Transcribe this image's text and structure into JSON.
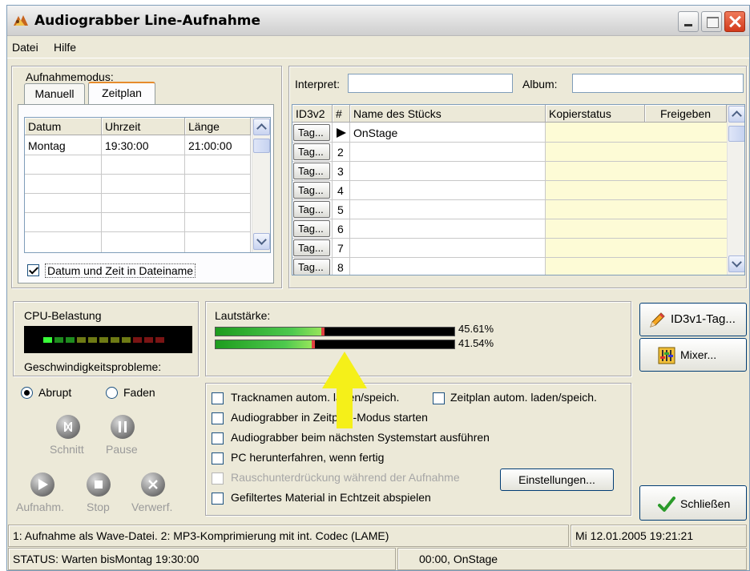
{
  "window": {
    "title": "Audiograbber Line-Aufnahme"
  },
  "menu": [
    {
      "label": "Datei"
    },
    {
      "label": "Hilfe"
    }
  ],
  "recording_mode": {
    "title": "Aufnahmemodus:",
    "tabs": [
      {
        "label": "Manuell"
      },
      {
        "label": "Zeitplan",
        "active": true
      }
    ],
    "schedule_table": {
      "columns": [
        "Datum",
        "Uhrzeit",
        "Länge"
      ],
      "rows": [
        [
          "Montag",
          "19:30:00",
          "21:00:00"
        ]
      ]
    },
    "date_in_filename": {
      "label": "Datum und Zeit in Dateiname",
      "checked": true
    }
  },
  "track_info": {
    "artist_label": "Interpret:",
    "artist_value": "",
    "album_label": "Album:",
    "album_value": "",
    "columns": [
      "ID3v2",
      "#",
      "Name des Stücks",
      "Kopierstatus",
      "Freigeben"
    ],
    "tag_button_label": "Tag...",
    "rows": [
      {
        "num": "",
        "name": "OnStage",
        "playing": true
      },
      {
        "num": "2",
        "name": ""
      },
      {
        "num": "3",
        "name": ""
      },
      {
        "num": "4",
        "name": ""
      },
      {
        "num": "5",
        "name": ""
      },
      {
        "num": "6",
        "name": ""
      },
      {
        "num": "7",
        "name": ""
      },
      {
        "num": "8",
        "name": ""
      }
    ]
  },
  "cpu": {
    "title": "CPU-Belastung",
    "footer": "Geschwindigkeitsprobleme:"
  },
  "volume": {
    "title": "Lautstärke:",
    "left_percent": 45.61,
    "right_percent": 41.54,
    "left_label": "45.61%",
    "right_label": "41.54%"
  },
  "buttons": {
    "id3v1": "ID3v1-Tag...",
    "mixer": "Mixer...",
    "settings": "Einstellungen...",
    "close": "Schließen"
  },
  "transition": {
    "abrupt": {
      "label": "Abrupt",
      "checked": true
    },
    "fade": {
      "label": "Faden",
      "checked": false
    }
  },
  "controls": {
    "cut": "Schnitt",
    "pause": "Pause",
    "record": "Aufnahm.",
    "stop": "Stop",
    "discard": "Verwerf."
  },
  "options": [
    {
      "label": "Tracknamen autom. laden/speich.",
      "checked": false,
      "disabled": false
    },
    {
      "label": "Zeitplan autom. laden/speich.",
      "checked": false,
      "disabled": false
    },
    {
      "label": "Audiograbber in Zeitplan-Modus starten",
      "checked": false,
      "disabled": false
    },
    {
      "label": "Audiograbber beim nächsten Systemstart ausführen",
      "checked": false,
      "disabled": false
    },
    {
      "label": "PC herunterfahren, wenn fertig",
      "checked": false,
      "disabled": false
    },
    {
      "label": "Rauschunterdrückung während der Aufnahme",
      "checked": false,
      "disabled": true
    },
    {
      "label": "Gefiltertes Material in Echtzeit abspielen",
      "checked": false,
      "disabled": false
    }
  ],
  "info_bar": {
    "message": "1: Aufnahme als Wave-Datei. 2: MP3-Komprimierung  mit int. Codec (LAME)",
    "datetime": "Mi 12.01.2005 19:21:21"
  },
  "status_bar": {
    "status": "STATUS: Warten bisMontag 19:30:00",
    "position": "00:00, OnStage"
  },
  "colors": {
    "window_bg": "#ece9d8",
    "copy_status_bg": "#fdfbd6",
    "accent_arrow": "#f5f019"
  }
}
